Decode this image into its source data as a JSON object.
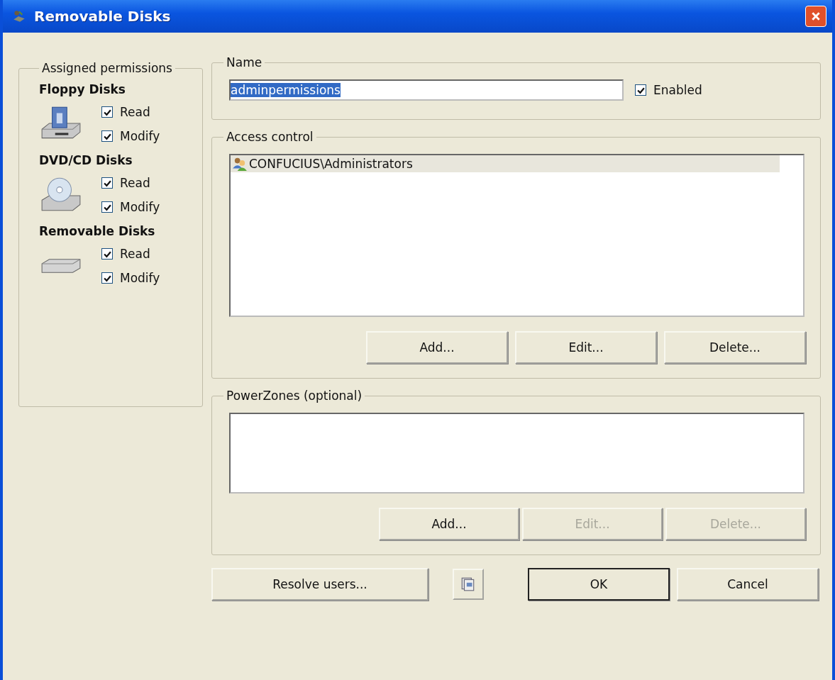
{
  "window": {
    "title": "Removable Disks"
  },
  "assigned_permissions": {
    "legend": "Assigned permissions",
    "devices": [
      {
        "kind": "floppy",
        "title": "Floppy Disks",
        "options": [
          {
            "label": "Read",
            "checked": true
          },
          {
            "label": "Modify",
            "checked": true
          }
        ]
      },
      {
        "kind": "cd",
        "title": "DVD/CD Disks",
        "options": [
          {
            "label": "Read",
            "checked": true
          },
          {
            "label": "Modify",
            "checked": true
          }
        ]
      },
      {
        "kind": "removable",
        "title": "Removable Disks",
        "options": [
          {
            "label": "Read",
            "checked": true
          },
          {
            "label": "Modify",
            "checked": true
          }
        ]
      }
    ]
  },
  "name_group": {
    "legend": "Name",
    "value": "adminpermissions",
    "enabled": {
      "label": "Enabled",
      "checked": true
    }
  },
  "access_control": {
    "legend": "Access control",
    "entries": [
      {
        "label": "CONFUCIUS\\Administrators",
        "selected": true
      }
    ],
    "buttons": [
      {
        "label": "Add...",
        "disabled": false
      },
      {
        "label": "Edit...",
        "disabled": false
      },
      {
        "label": "Delete...",
        "disabled": false
      }
    ]
  },
  "power_zones": {
    "legend": "PowerZones (optional)",
    "buttons": [
      {
        "label": "Add...",
        "disabled": false
      },
      {
        "label": "Edit...",
        "disabled": true
      },
      {
        "label": "Delete...",
        "disabled": true
      }
    ]
  },
  "footer": {
    "resolve": {
      "label": "Resolve users..."
    },
    "ok": {
      "label": "OK",
      "default": true
    },
    "cancel": {
      "label": "Cancel"
    }
  }
}
